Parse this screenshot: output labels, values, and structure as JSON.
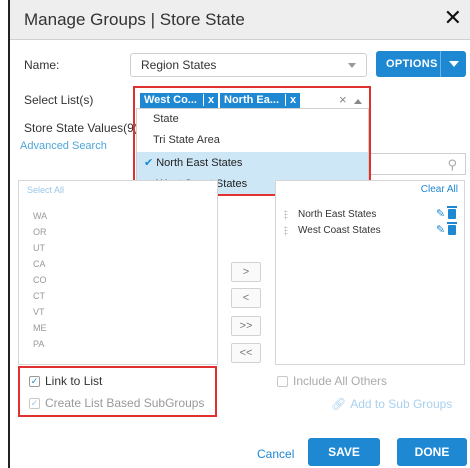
{
  "dialog": {
    "title": "Manage Groups | Store State",
    "close_icon": "close-icon"
  },
  "name": {
    "label": "Name:",
    "value": "Region States"
  },
  "options_button": {
    "label": "OPTIONS"
  },
  "select_lists": {
    "label": "Select List(s)",
    "tags": [
      "West Co...",
      "North Ea..."
    ],
    "tag_remove": "x",
    "clear": "×",
    "options": [
      {
        "label": "State",
        "selected": false
      },
      {
        "label": "Tri State Area",
        "selected": false
      },
      {
        "label": "North East States",
        "selected": true
      },
      {
        "label": "West Coast States",
        "selected": true
      }
    ]
  },
  "store_state_values": {
    "label": "Store State Values(9)",
    "advanced_search": "Advanced Search",
    "select_all": "Select All",
    "items": [
      "WA",
      "OR",
      "UT",
      "CA",
      "CO",
      "CT",
      "VT",
      "ME",
      "PA"
    ]
  },
  "selected_panel": {
    "clear_all": "Clear All",
    "items": [
      "North East States",
      "West Coast States"
    ]
  },
  "move_buttons": [
    ">",
    "<",
    ">>",
    "<<"
  ],
  "checkboxes": {
    "link_to_list": {
      "label": "Link to List",
      "checked": true
    },
    "create_subgroups": {
      "label": "Create List Based SubGroups",
      "checked": true
    },
    "include_all_others": {
      "label": "Include All Others",
      "checked": false
    }
  },
  "add_to_sub_groups": "Add to Sub Groups",
  "footer": {
    "cancel": "Cancel",
    "save": "SAVE",
    "done": "DONE"
  },
  "colors": {
    "accent": "#1e88d2",
    "highlight_box": "#e03030",
    "selected_row": "#cde7f7"
  }
}
